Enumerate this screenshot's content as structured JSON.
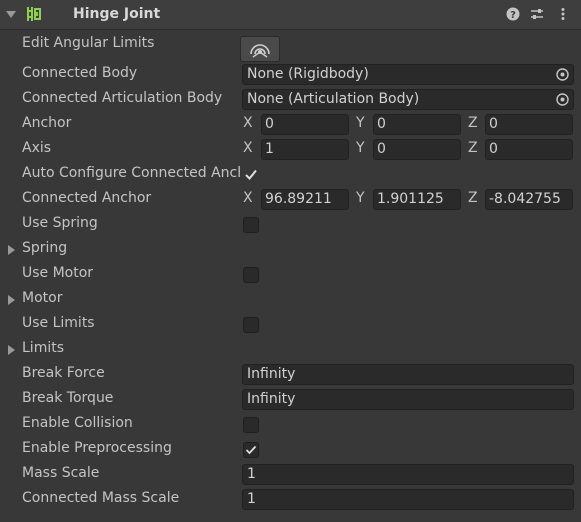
{
  "component": {
    "title": "Hinge Joint",
    "icon": "hinge-joint-icon",
    "header_icons": [
      "help-icon",
      "preset-icon",
      "menu-icon"
    ]
  },
  "fields": {
    "edit_angular_limits": {
      "label": "Edit Angular Limits",
      "icon": "edit-angular-limits-icon"
    },
    "connected_body": {
      "label": "Connected Body",
      "value": "None (Rigidbody)"
    },
    "connected_articulation_body": {
      "label": "Connected Articulation Body",
      "value": "None (Articulation Body)"
    },
    "anchor": {
      "label": "Anchor",
      "x": "0",
      "y": "0",
      "z": "0"
    },
    "axis": {
      "label": "Axis",
      "x": "1",
      "y": "0",
      "z": "0"
    },
    "auto_configure": {
      "label": "Auto Configure Connected Anchor",
      "checked": true
    },
    "connected_anchor": {
      "label": "Connected Anchor",
      "x": "96.89211",
      "y": "1.901125",
      "z": "-8.042755"
    },
    "use_spring": {
      "label": "Use Spring",
      "checked": false
    },
    "spring": {
      "label": "Spring"
    },
    "use_motor": {
      "label": "Use Motor",
      "checked": false
    },
    "motor": {
      "label": "Motor"
    },
    "use_limits": {
      "label": "Use Limits",
      "checked": false
    },
    "limits": {
      "label": "Limits"
    },
    "break_force": {
      "label": "Break Force",
      "value": "Infinity"
    },
    "break_torque": {
      "label": "Break Torque",
      "value": "Infinity"
    },
    "enable_collision": {
      "label": "Enable Collision",
      "checked": false
    },
    "enable_preprocessing": {
      "label": "Enable Preprocessing",
      "checked": true
    },
    "mass_scale": {
      "label": "Mass Scale",
      "value": "1"
    },
    "connected_mass_scale": {
      "label": "Connected Mass Scale",
      "value": "1"
    }
  },
  "axis_letters": {
    "x": "X",
    "y": "Y",
    "z": "Z"
  },
  "colors": {
    "background": "#383838",
    "field_background": "#2a2a2a",
    "text": "#c4c4c4",
    "component_icon": "#8fd14f"
  }
}
